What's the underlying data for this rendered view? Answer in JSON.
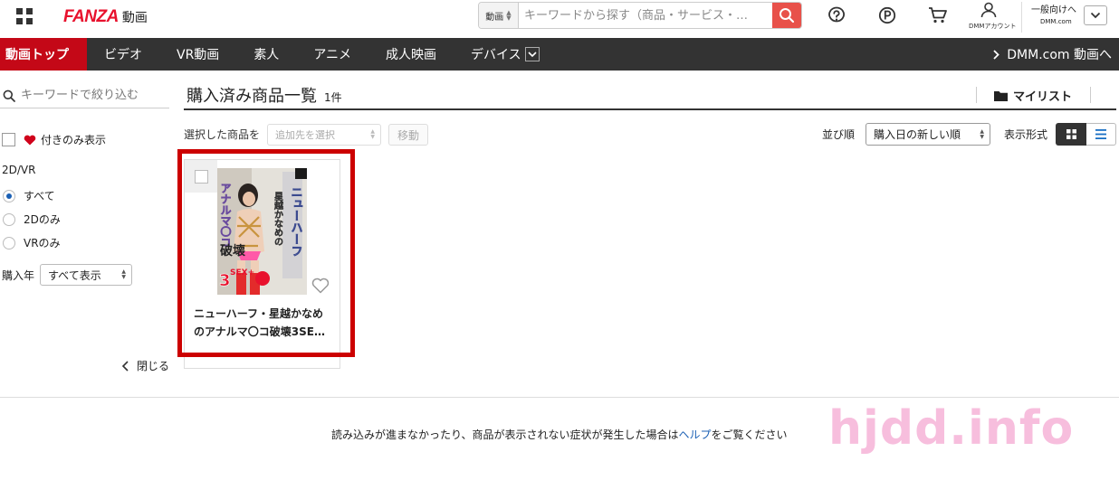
{
  "header": {
    "logo_mark": "FANZA",
    "logo_sub": "動画",
    "search_category": "動画",
    "search_placeholder": "キーワードから探す（商品・サービス・…",
    "account_label": "DMMアカウント",
    "account_type_line1": "一般向けへ",
    "account_type_line2": "DMM.com",
    "icons": [
      "apps-grid-icon",
      "search-icon",
      "help-icon",
      "point-icon",
      "cart-icon",
      "user-icon",
      "chevron-down-icon"
    ]
  },
  "nav": {
    "items": [
      {
        "label": "動画トップ",
        "active": true
      },
      {
        "label": "ビデオ"
      },
      {
        "label": "VR動画"
      },
      {
        "label": "素人"
      },
      {
        "label": "アニメ"
      },
      {
        "label": "成人映画"
      },
      {
        "label": "デバイス"
      }
    ],
    "right_link": "DMM.com 動画へ"
  },
  "sidebar": {
    "search_placeholder": "キーワードで絞り込む",
    "favorite_filter_label": "付きのみ表示",
    "dimension_label": "2D/VR",
    "dimension_options": [
      {
        "label": "すべて",
        "selected": true
      },
      {
        "label": "2Dのみ",
        "selected": false
      },
      {
        "label": "VRのみ",
        "selected": false
      }
    ],
    "year_label": "購入年",
    "year_value": "すべて表示",
    "close_label": "閉じる"
  },
  "main": {
    "title": "購入済み商品一覧",
    "count": "1件",
    "mylist_label": "マイリスト",
    "selected_label": "選択した商品を",
    "destination_placeholder": "追加先を選択",
    "move_button": "移動",
    "sort_label": "並び順",
    "sort_value": "購入日の新しい順",
    "view_label": "表示形式",
    "items": [
      {
        "title": "ニューハーフ・星越かなめのアナルマ〇コ破壊3SE…",
        "cover_text_vertical": "ニューハーフ・星越かなめのアナルマ〇コ破壊",
        "cover_text_badge": "3SEX+",
        "favorited": false
      }
    ]
  },
  "footer": {
    "message_before": "読み込みが進まなかったり、商品が表示されない症状が発生した場合は",
    "help_link": "ヘルプ",
    "message_after": "をご覧ください"
  },
  "watermark": "hjdd.info",
  "colors": {
    "brand_red": "#e8112d",
    "nav_bg": "#333333",
    "nav_active": "#c40817",
    "search_button": "#e8514a",
    "highlight_border": "#cc0000",
    "watermark": "#f7bedd",
    "link": "#1a5fb4"
  }
}
